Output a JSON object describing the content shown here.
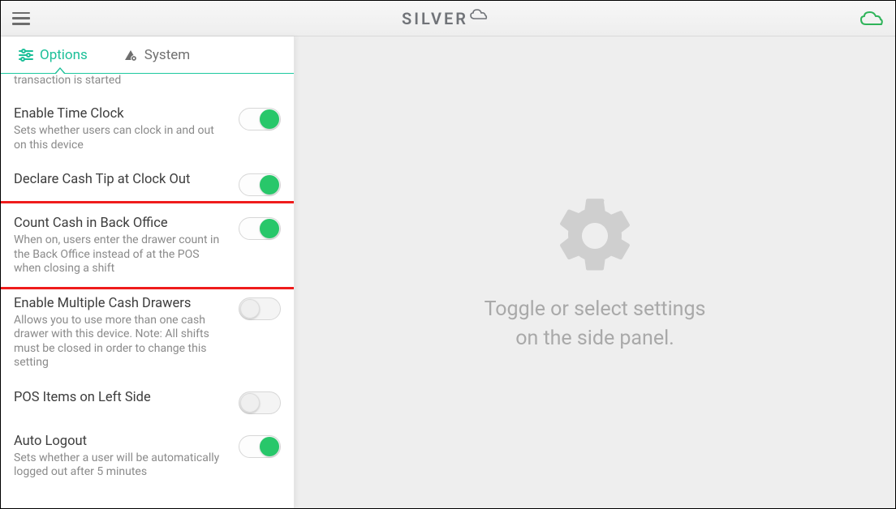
{
  "header": {
    "brand": "SILVER"
  },
  "tabs": {
    "options": "Options",
    "system": "System"
  },
  "cutoff_line": "transaction is started",
  "settings": [
    {
      "title": "Enable Time Clock",
      "desc": "Sets whether users can clock in and out on this device",
      "on": true,
      "name": "toggle-enable-time-clock"
    },
    {
      "title": "Declare Cash Tip at Clock Out",
      "desc": "",
      "on": true,
      "name": "toggle-declare-cash-tip"
    },
    {
      "title": "Count Cash in Back Office",
      "desc": "When on, users enter the drawer count in the Back Office instead of at the POS when closing a shift",
      "on": true,
      "name": "toggle-count-cash-back-office",
      "highlighted": true
    },
    {
      "title": "Enable Multiple Cash Drawers",
      "desc": "Allows you to use more than one cash drawer with this device. Note: All shifts must be closed in order to change this setting",
      "on": false,
      "name": "toggle-enable-multiple-drawers"
    },
    {
      "title": "POS Items on Left Side",
      "desc": "",
      "on": false,
      "name": "toggle-pos-items-left"
    },
    {
      "title": "Auto Logout",
      "desc": "Sets whether a user will be automatically logged out after 5 minutes",
      "on": true,
      "name": "toggle-auto-logout"
    }
  ],
  "main": {
    "line1": "Toggle or select settings",
    "line2": "on the side panel."
  },
  "colors": {
    "accent": "#1bbf98",
    "toggle_on": "#28c76a",
    "highlight": "#ef1c1c"
  }
}
